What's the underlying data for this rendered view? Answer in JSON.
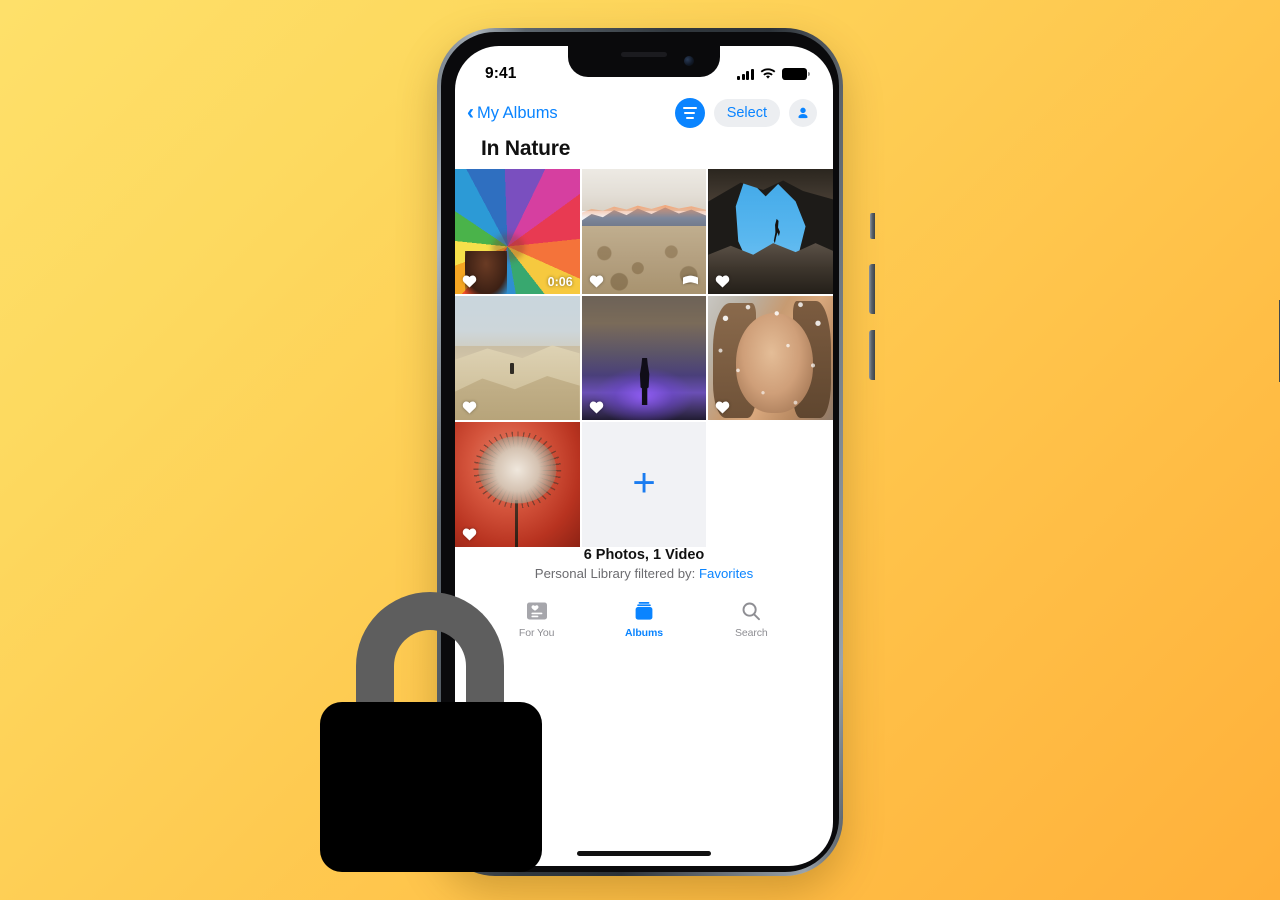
{
  "background": {
    "gradient_from": "#FEE06A",
    "gradient_to": "#FFB03A"
  },
  "accent_color": "#0a84ff",
  "status_bar": {
    "time": "9:41",
    "cellular_icon": "cellular-bars-icon",
    "wifi_icon": "wifi-icon",
    "battery_icon": "battery-icon"
  },
  "nav_bar": {
    "back_label": "My Albums",
    "back_chevron": "‹",
    "filter_icon": "filter-icon",
    "select_label": "Select",
    "account_icon": "person-icon"
  },
  "album": {
    "title": "In Nature",
    "footer_count": "6 Photos, 1 Video",
    "footer_filter_prefix": "Personal Library filtered by: ",
    "footer_filter_link": "Favorites"
  },
  "grid": {
    "add_label": "+",
    "items": [
      {
        "name": "photo-rainbow-parachute",
        "art": "art-parachute",
        "favorite": true,
        "duration": "0:06",
        "badge": ""
      },
      {
        "name": "photo-desert-mountains",
        "art": "art-mountain",
        "favorite": true,
        "duration": "",
        "badge": "panorama-icon"
      },
      {
        "name": "photo-cave-climber",
        "art": "art-cave",
        "favorite": true,
        "duration": "",
        "badge": ""
      },
      {
        "name": "photo-sand-dune",
        "art": "art-dune",
        "favorite": true,
        "duration": "",
        "badge": ""
      },
      {
        "name": "photo-purple-silhouette",
        "art": "art-purple",
        "favorite": true,
        "duration": "",
        "badge": ""
      },
      {
        "name": "photo-portrait-water",
        "art": "art-portrait",
        "favorite": true,
        "duration": "",
        "badge": ""
      },
      {
        "name": "photo-dandelion-red",
        "art": "art-dandelion",
        "favorite": true,
        "duration": "",
        "badge": ""
      }
    ]
  },
  "tab_bar": {
    "tabs": [
      {
        "label": "For You",
        "icon": "for-you-card-icon",
        "active": false
      },
      {
        "label": "Albums",
        "icon": "albums-stack-icon",
        "active": true
      },
      {
        "label": "Search",
        "icon": "search-icon",
        "active": false
      }
    ]
  },
  "overlay": {
    "lock_icon": "padlock-icon",
    "shackle_color": "#5e5e5e",
    "body_color": "#000000"
  }
}
